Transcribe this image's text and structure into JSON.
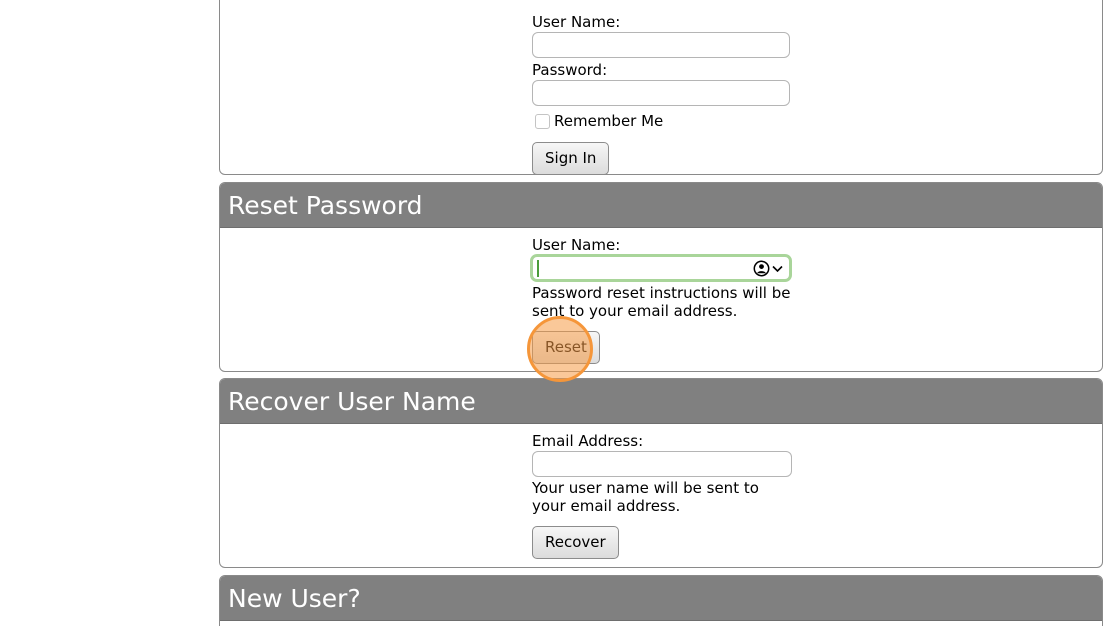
{
  "sign_in": {
    "username_label": "User Name:",
    "password_label": "Password:",
    "remember_label": "Remember Me",
    "sign_in_button": "Sign In"
  },
  "reset_password": {
    "title": "Reset Password",
    "username_label": "User Name:",
    "note": "Password reset instructions will be sent to your email address.",
    "reset_button": "Reset"
  },
  "recover_username": {
    "title": "Recover User Name",
    "email_label": "Email Address:",
    "note": "Your user name will be sent to your email address.",
    "recover_button": "Recover"
  },
  "new_user": {
    "title": "New User?"
  },
  "colors": {
    "header_bg": "#808080",
    "focus_ring": "#a9d59a",
    "click_highlight": "#f5963a"
  }
}
